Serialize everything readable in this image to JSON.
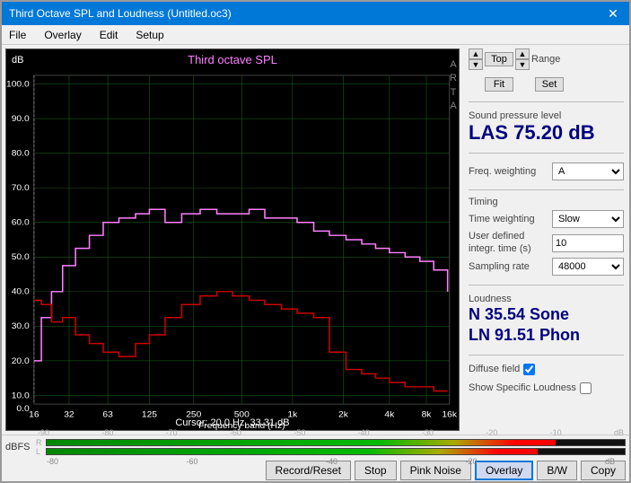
{
  "window": {
    "title": "Third Octave SPL and Loudness (Untitled.oc3)",
    "close_label": "✕"
  },
  "menu": {
    "items": [
      "File",
      "Overlay",
      "Edit",
      "Setup"
    ]
  },
  "chart": {
    "title": "Third octave SPL",
    "db_label": "dB",
    "cursor_info": "Cursor:  20.0 Hz, 33.31 dB",
    "x_label": "Frequency band (Hz)",
    "arta_lines": [
      "A",
      "R",
      "T",
      "A"
    ],
    "y_ticks": [
      "100.0",
      "90.0",
      "80.0",
      "70.0",
      "60.0",
      "50.0",
      "40.0",
      "30.0",
      "20.0",
      "10.0",
      "0.0"
    ],
    "x_ticks": [
      "16",
      "32",
      "63",
      "125",
      "250",
      "500",
      "1k",
      "2k",
      "4k",
      "8k",
      "16k"
    ]
  },
  "right_panel": {
    "top_btn": "Top",
    "fit_btn": "Fit",
    "range_label": "Range",
    "set_btn": "Set",
    "spl_section_label": "Sound pressure level",
    "spl_value": "LAS 75.20 dB",
    "freq_weighting_label": "Freq. weighting",
    "freq_weighting_value": "A",
    "timing_label": "Timing",
    "time_weighting_label": "Time weighting",
    "time_weighting_value": "Slow",
    "user_integr_label": "User defined integr. time (s)",
    "user_integr_value": "10",
    "sampling_rate_label": "Sampling rate",
    "sampling_rate_value": "48000",
    "loudness_label": "Loudness",
    "loudness_n": "N 35.54 Sone",
    "loudness_ln": "LN 91.51 Phon",
    "diffuse_field_label": "Diffuse field",
    "diffuse_field_checked": true,
    "show_specific_label": "Show Specific Loudness",
    "show_specific_checked": false
  },
  "bottom": {
    "dbfs_label": "dBFS",
    "r_label": "R",
    "l_label": "L",
    "meter_ticks": [
      "-90",
      "-80",
      "-70",
      "-60",
      "-50",
      "-40",
      "-30",
      "-20",
      "-10",
      "dB"
    ],
    "meter_ticks2": [
      "-80",
      "-60",
      "-40",
      "-20",
      "dB"
    ],
    "record_reset_btn": "Record/Reset",
    "stop_btn": "Stop",
    "pink_noise_btn": "Pink Noise",
    "overlay_btn": "Overlay",
    "bw_btn": "B/W",
    "copy_btn": "Copy"
  }
}
